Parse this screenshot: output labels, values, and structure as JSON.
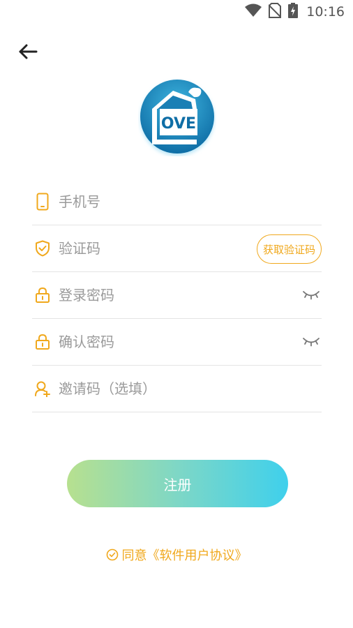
{
  "status_bar": {
    "time": "10:16",
    "icons": [
      "wifi-icon",
      "no-sim-icon",
      "battery-charging-icon"
    ]
  },
  "header": {
    "back_icon": "arrow-left-icon"
  },
  "logo": {
    "text": "OVE",
    "colors": {
      "primary": "#1a7fb5",
      "light": "#3fb6e0"
    }
  },
  "form": {
    "phone": {
      "placeholder": "手机号",
      "icon": "phone-icon",
      "value": ""
    },
    "code": {
      "placeholder": "验证码",
      "icon": "shield-check-icon",
      "value": "",
      "button_label": "获取验证码"
    },
    "password": {
      "placeholder": "登录密码",
      "icon": "lock-icon",
      "value": "",
      "toggle_icon": "eye-closed-icon"
    },
    "confirm_password": {
      "placeholder": "确认密码",
      "icon": "lock-icon",
      "value": "",
      "toggle_icon": "eye-closed-icon"
    },
    "invite": {
      "placeholder": "邀请码（选填）",
      "icon": "user-add-icon",
      "value": ""
    }
  },
  "register": {
    "label": "注册"
  },
  "agreement": {
    "text": "同意《软件用户协议》",
    "icon": "check-circle-icon"
  },
  "colors": {
    "accent": "#f0a81c",
    "gradient_start": "#b7e08f",
    "gradient_end": "#3fd0ec",
    "placeholder": "#9a9a9a",
    "divider": "#e4e4e4"
  }
}
